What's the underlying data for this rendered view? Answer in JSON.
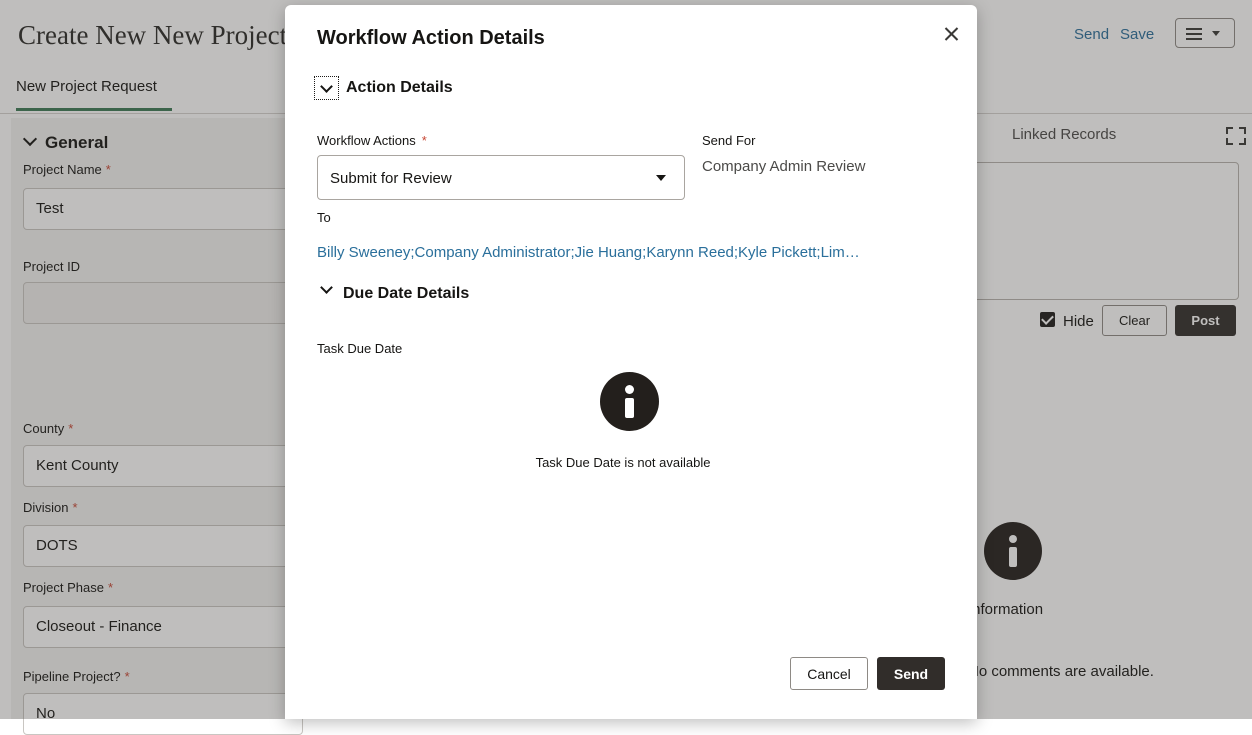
{
  "page": {
    "title": "Create New New Project Request",
    "tab_label": "New Project Request",
    "send_link": "Send",
    "save_link": "Save",
    "menu_icon": "hamburger-icon"
  },
  "general": {
    "section_title": "General",
    "fields": [
      {
        "label": "Project Name",
        "required": "*",
        "value": "Test"
      },
      {
        "label": "Project ID",
        "required": "",
        "value": ""
      },
      {
        "label": "County",
        "required": "*",
        "value": "Kent County"
      },
      {
        "label": "Division",
        "required": "*",
        "value": "DOTS"
      },
      {
        "label": "Project Phase",
        "required": "*",
        "value": "Closeout - Finance"
      },
      {
        "label": "Pipeline Project?",
        "required": "*",
        "value": "No"
      }
    ]
  },
  "right_panel": {
    "tab_label": "Linked Records",
    "hide_label": "Hide",
    "clear_button": "Clear",
    "post_button": "Post",
    "empty_title": "Information",
    "empty_text": "No comments are available."
  },
  "modal": {
    "title": "Workflow Action Details",
    "action_details_heading": "Action Details",
    "workflow_actions_label": "Workflow Actions",
    "required_mark": "*",
    "workflow_actions_value": "Submit for Review",
    "send_for_label": "Send For",
    "send_for_value": "Company Admin Review",
    "to_label": "To",
    "to_value": "Billy Sweeney;Company Administrator;Jie Huang;Karynn Reed;Kyle Pickett;Lim…",
    "due_date_heading": "Due Date Details",
    "task_due_date_label": "Task Due Date",
    "task_due_date_empty": "Task Due Date is not available",
    "cancel_button": "Cancel",
    "send_button": "Send"
  },
  "colors": {
    "accent_link": "#2a6f9b",
    "primary_button": "#312d2a",
    "required": "#c74634",
    "tab_underline": "#3c7a55"
  }
}
